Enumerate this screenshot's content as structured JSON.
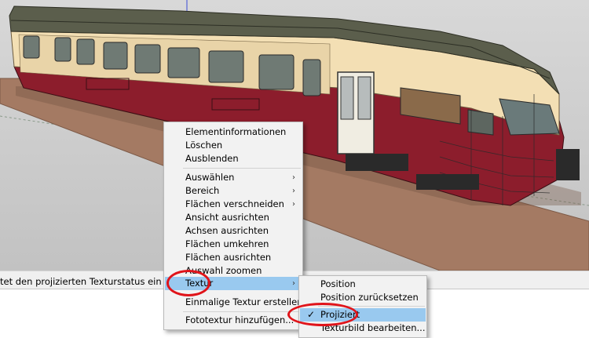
{
  "status_bar": {
    "text": "tet den projizierten Texturstatus ein und aus"
  },
  "context_menu": {
    "items": [
      {
        "label": "Elementinformationen"
      },
      {
        "label": "Löschen"
      },
      {
        "label": "Ausblenden"
      },
      {
        "label": "Auswählen",
        "submenu": true
      },
      {
        "label": "Bereich",
        "submenu": true
      },
      {
        "label": "Flächen verschneiden",
        "submenu": true
      },
      {
        "label": "Ansicht ausrichten"
      },
      {
        "label": "Achsen ausrichten"
      },
      {
        "label": "Flächen umkehren"
      },
      {
        "label": "Flächen ausrichten"
      },
      {
        "label": "Auswahl zoomen"
      },
      {
        "label": "Textur",
        "submenu": true,
        "highlighted": true
      },
      {
        "label": "Einmalige Textur erstellen"
      },
      {
        "label": "Fototextur hinzufügen..."
      }
    ],
    "arrow_glyph": "›"
  },
  "texture_submenu": {
    "items": [
      {
        "label": "Position"
      },
      {
        "label": "Position zurücksetzen"
      },
      {
        "label": "Projiziert",
        "checked": true,
        "highlighted": true
      },
      {
        "label": "Texturbild bearbeiten..."
      }
    ],
    "check_glyph": "✓"
  },
  "colors": {
    "menu_highlight": "#99c9ef",
    "annotation_red": "#e0141a",
    "train_cream": "#f3dfb4",
    "train_red": "#8c1d2c",
    "roof": "#5b5e4c"
  }
}
